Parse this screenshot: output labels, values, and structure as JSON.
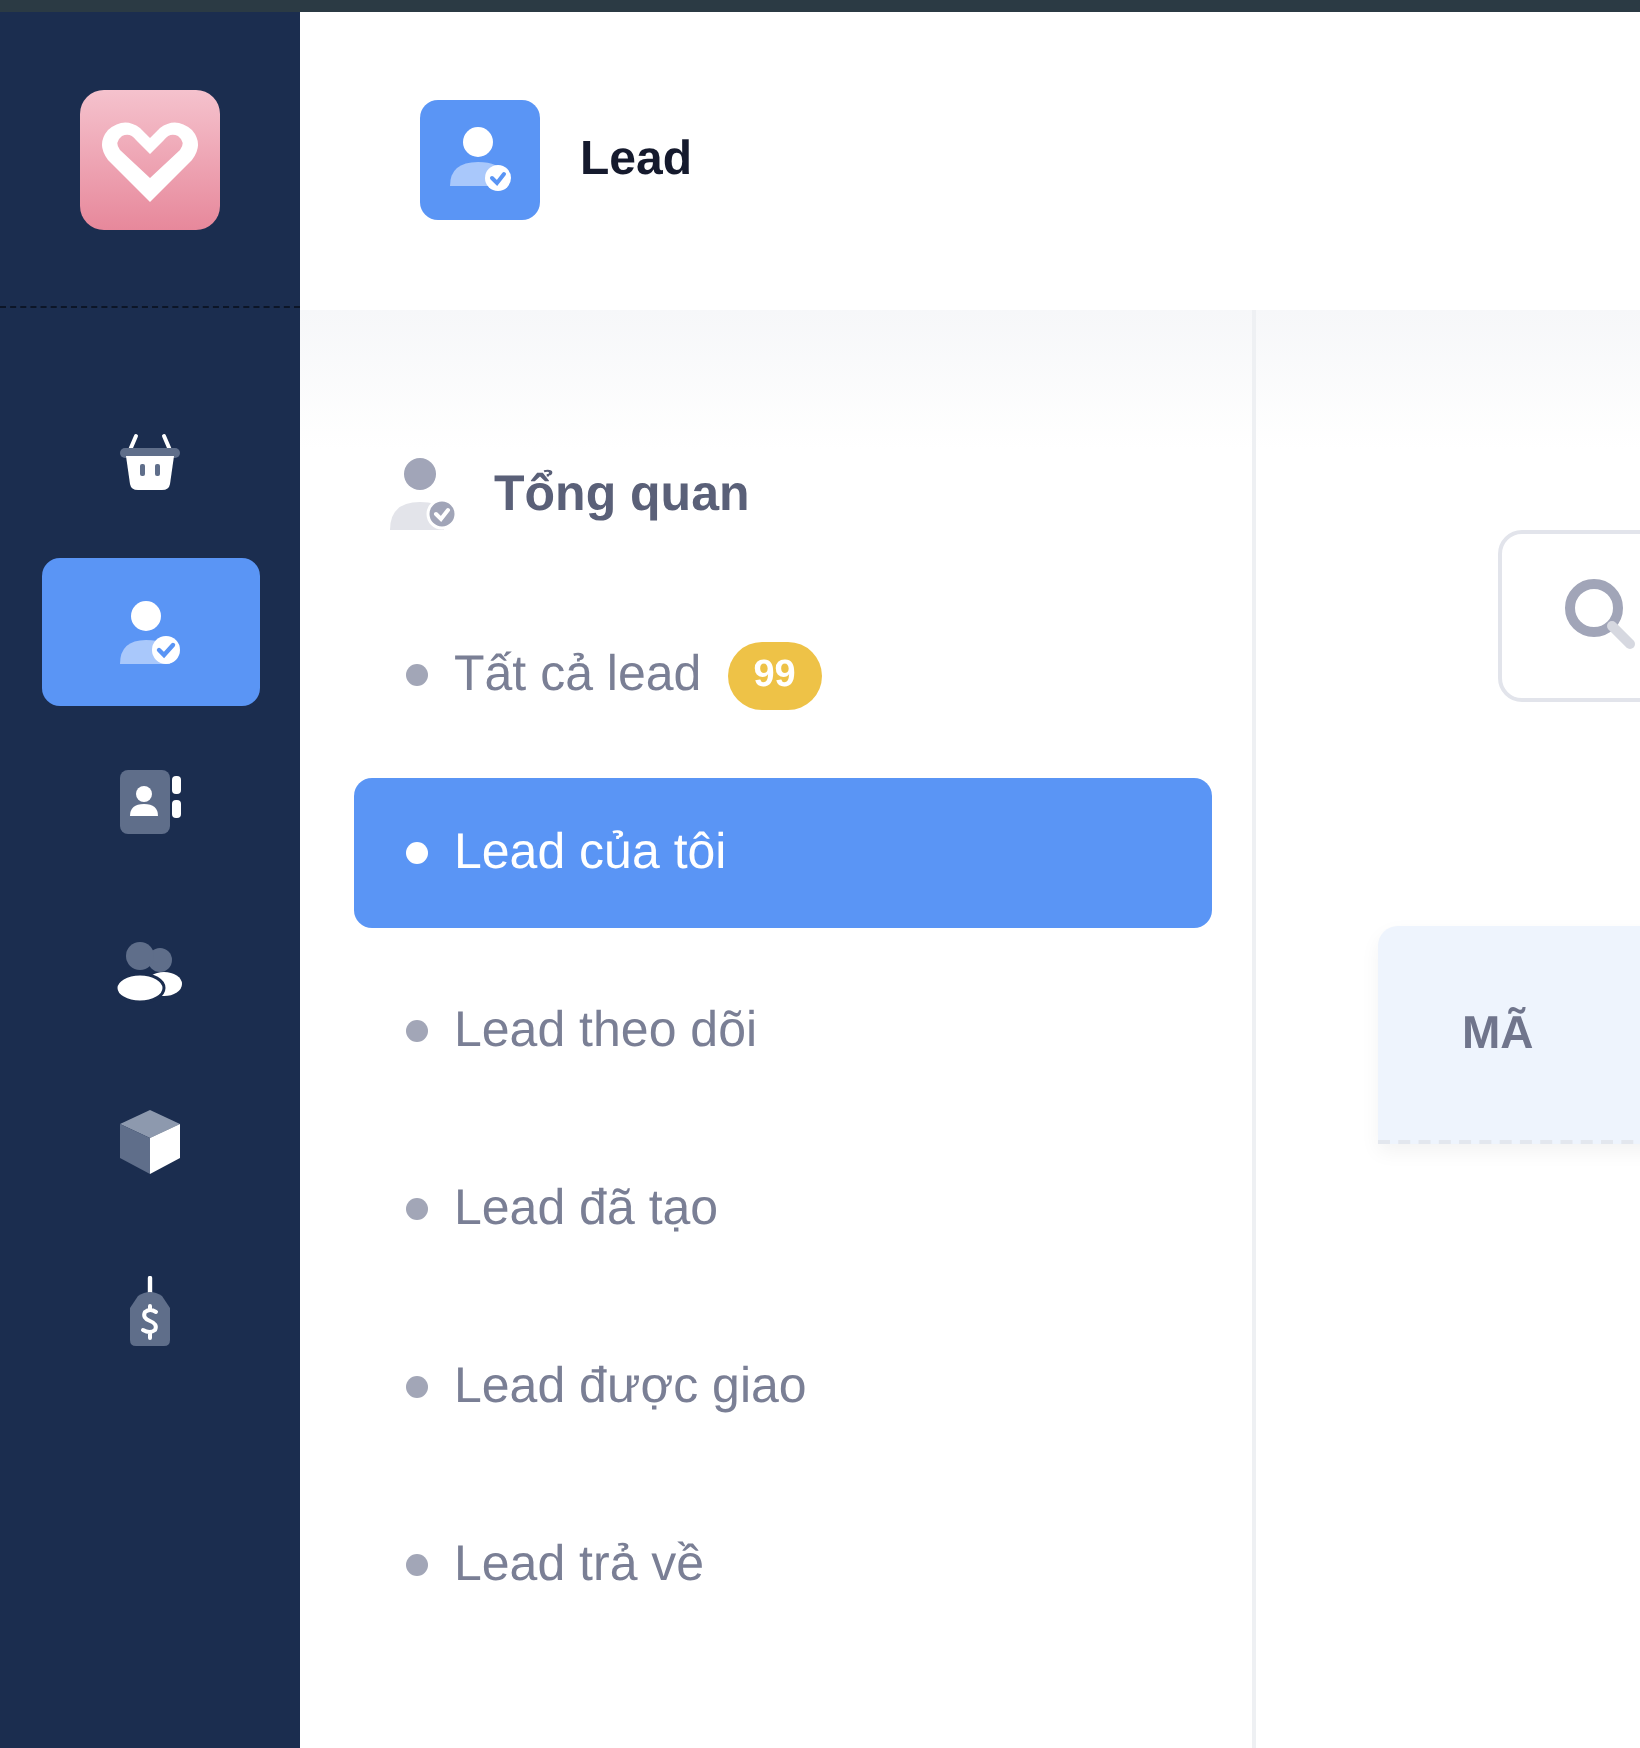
{
  "rail": [
    {
      "kind": "basket",
      "selected": false
    },
    {
      "kind": "lead",
      "selected": true
    },
    {
      "kind": "contacts",
      "selected": false
    },
    {
      "kind": "users",
      "selected": false
    },
    {
      "kind": "box",
      "selected": false
    },
    {
      "kind": "tag",
      "selected": false
    }
  ],
  "header": {
    "title": "Lead"
  },
  "submenu": {
    "heading": "Tổng quan",
    "items": [
      {
        "label": "Tất cả lead",
        "badge": "99",
        "selected": false
      },
      {
        "label": "Lead của tôi",
        "selected": true
      },
      {
        "label": "Lead theo dõi",
        "selected": false
      },
      {
        "label": "Lead đã tạo",
        "selected": false
      },
      {
        "label": "Lead được giao",
        "selected": false
      },
      {
        "label": "Lead trả về",
        "selected": false
      }
    ]
  },
  "table": {
    "columns": [
      "MÃ"
    ]
  }
}
